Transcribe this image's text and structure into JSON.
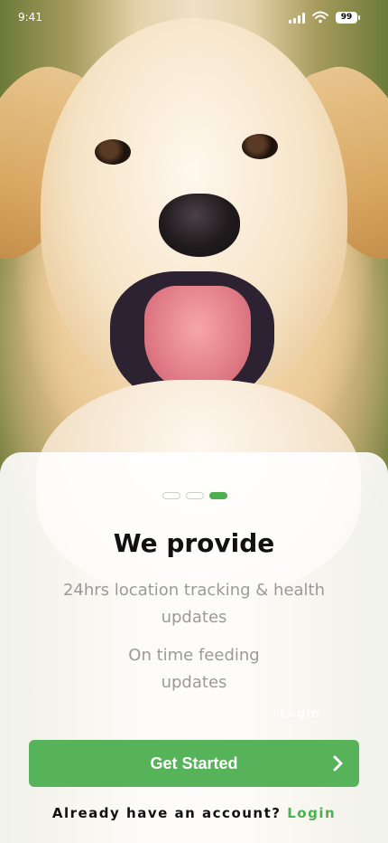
{
  "status_bar": {
    "time": "9:41",
    "battery": "99"
  },
  "pager": {
    "current": 3,
    "total": 3
  },
  "content": {
    "title": "We provide",
    "lines": [
      "24hrs location tracking & health",
      "updates",
      "On time feeding",
      "updates"
    ],
    "ghost_login": "Login"
  },
  "actions": {
    "primary": "Get Started",
    "account_prompt": "Already have an account?",
    "login_link": "Login"
  },
  "colors": {
    "accent": "#57b35a",
    "link": "#4caf50"
  },
  "icons": [
    "signal-icon",
    "wifi-icon",
    "battery-icon",
    "chevron-right-icon"
  ]
}
